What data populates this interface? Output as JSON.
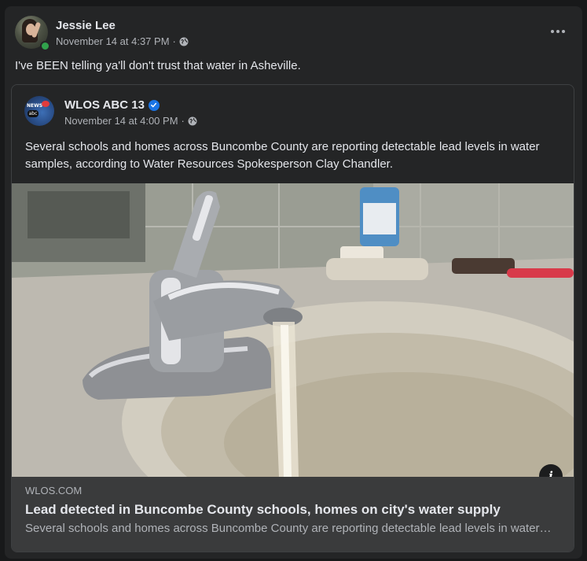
{
  "post": {
    "author": "Jessie Lee",
    "timestamp": "November 14 at 4:37 PM",
    "separator": "·",
    "text": "I've BEEN telling ya'll don't trust that water in Asheville.",
    "more_icon": "more-dots-icon",
    "privacy_icon": "globe-icon"
  },
  "shared": {
    "page_name": "WLOS ABC 13",
    "verified": true,
    "timestamp": "November 14 at 4:00 PM",
    "separator": "·",
    "text": "Several schools and homes across Buncombe County are reporting detectable lead levels in water samples, according to Water Resources Spokesperson Clay Chandler.",
    "avatar_text_top": "NEWS",
    "avatar_text_logo": "abc",
    "link": {
      "domain": "WLOS.COM",
      "title": "Lead detected in Buncombe County schools, homes on city's water supply",
      "description": "Several schools and homes across Buncombe County are reporting detectable lead levels in water samples, according to Water Resources Spokesperson Clay Chandler.",
      "info_label": "i"
    }
  },
  "colors": {
    "background": "#18191a",
    "card": "#242526",
    "link_panel": "#3a3b3c",
    "verified_blue": "#1b74e4",
    "online_green": "#31a24c"
  }
}
